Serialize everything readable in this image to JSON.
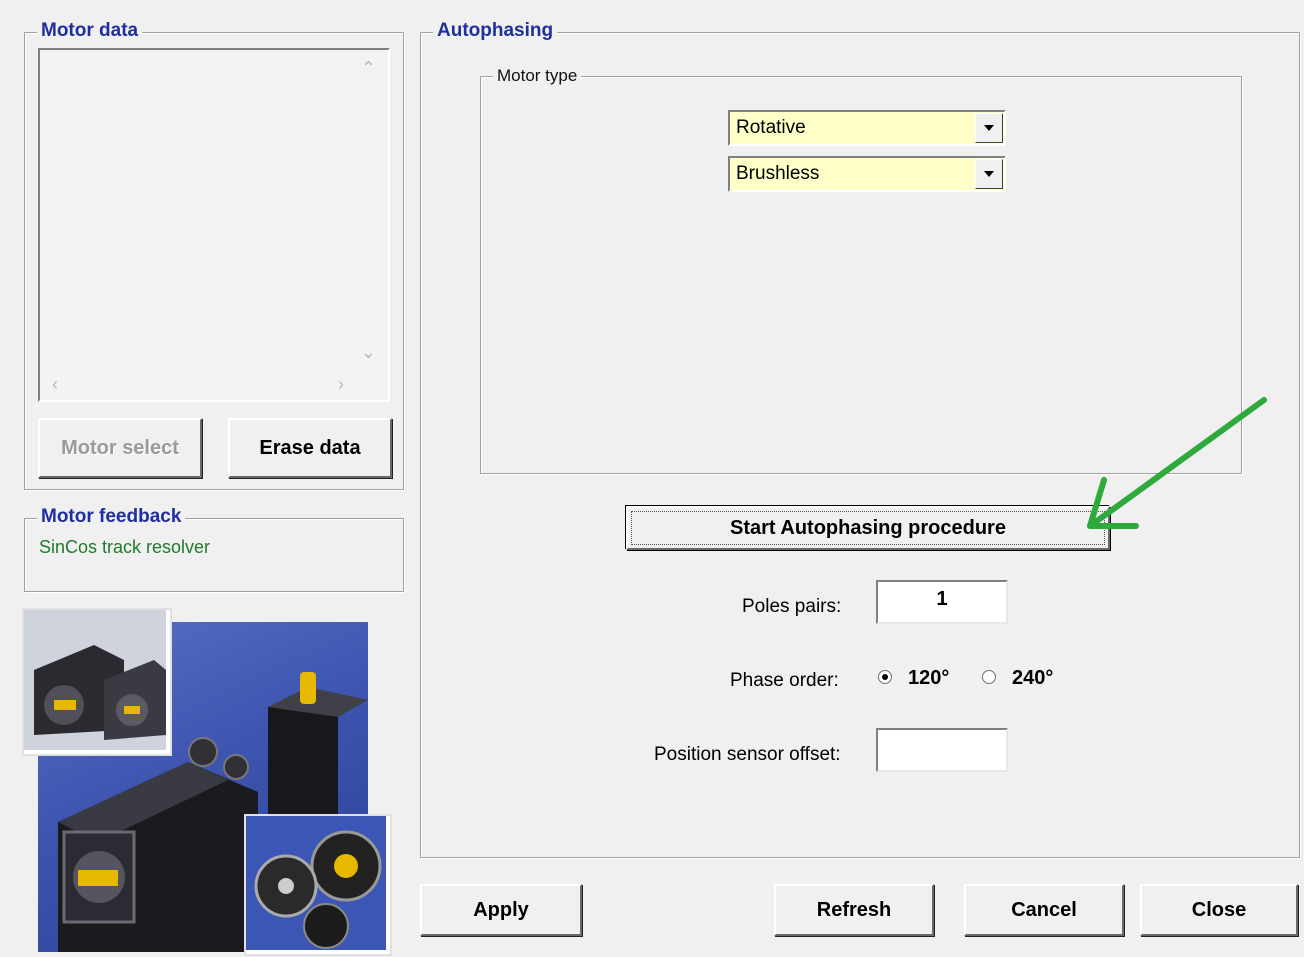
{
  "motor_data": {
    "title": "Motor data",
    "motor_select_label": "Motor select",
    "erase_data_label": "Erase data"
  },
  "motor_feedback": {
    "title": "Motor feedback",
    "value": "SinCos track resolver"
  },
  "autophasing": {
    "title": "Autophasing",
    "motor_type": {
      "title": "Motor type",
      "motion_select": {
        "value": "Rotative"
      },
      "motor_kind_select": {
        "value": "Brushless"
      }
    },
    "start_button_label": "Start Autophasing procedure",
    "poles_pairs": {
      "label": "Poles pairs:",
      "value": "1"
    },
    "phase_order": {
      "label": "Phase order:",
      "options": [
        {
          "label": "120°",
          "selected": true
        },
        {
          "label": "240°",
          "selected": false
        }
      ]
    },
    "position_sensor_offset": {
      "label": "Position sensor offset:",
      "value": ""
    }
  },
  "footer_buttons": {
    "apply": "Apply",
    "refresh": "Refresh",
    "cancel": "Cancel",
    "close": "Close"
  },
  "colors": {
    "group_title": "#1f2fa0",
    "feedback_text": "#1f7a2a",
    "combo_bg": "#ffffc8",
    "annotation_arrow": "#2eaa3c"
  },
  "icons": {
    "annotation": "green-arrow-icon",
    "motor_images": "motor-photo-collage"
  }
}
